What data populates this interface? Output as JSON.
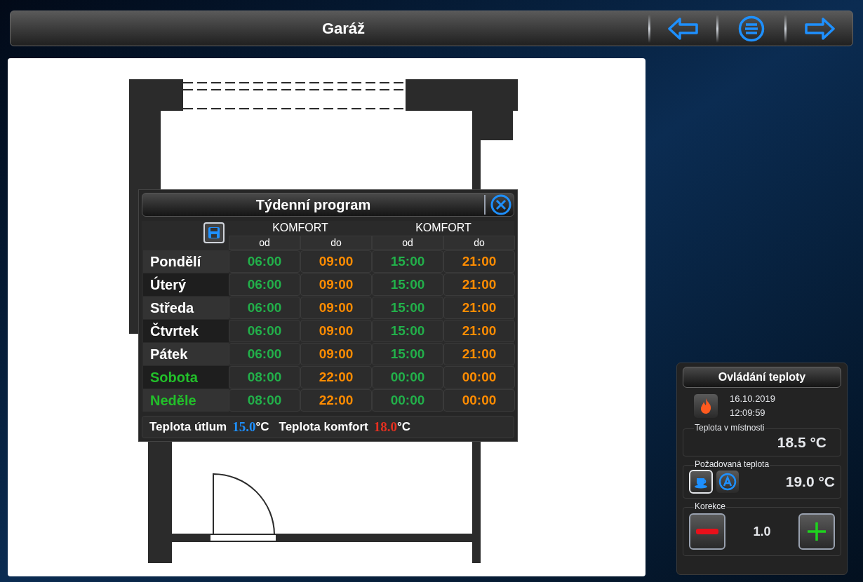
{
  "header": {
    "title": "Garáž"
  },
  "program": {
    "title": "Týdenní program",
    "groups": [
      "KOMFORT",
      "KOMFORT"
    ],
    "subheaders": [
      "od",
      "do",
      "od",
      "do"
    ],
    "days": [
      {
        "name": "Pondělí",
        "color": "#ffffff",
        "times": [
          "06:00",
          "09:00",
          "15:00",
          "21:00"
        ]
      },
      {
        "name": "Úterý",
        "color": "#ffffff",
        "times": [
          "06:00",
          "09:00",
          "15:00",
          "21:00"
        ]
      },
      {
        "name": "Středa",
        "color": "#ffffff",
        "times": [
          "06:00",
          "09:00",
          "15:00",
          "21:00"
        ]
      },
      {
        "name": "Čtvrtek",
        "color": "#ffffff",
        "times": [
          "06:00",
          "09:00",
          "15:00",
          "21:00"
        ]
      },
      {
        "name": "Pátek",
        "color": "#ffffff",
        "times": [
          "06:00",
          "09:00",
          "15:00",
          "21:00"
        ]
      },
      {
        "name": "Sobota",
        "color": "#22c02a",
        "times": [
          "08:00",
          "22:00",
          "00:00",
          "00:00"
        ]
      },
      {
        "name": "Neděle",
        "color": "#22c02a",
        "times": [
          "08:00",
          "22:00",
          "00:00",
          "00:00"
        ]
      }
    ],
    "footer": {
      "setback_label": "Teplota útlum",
      "setback_value": "15.0",
      "setback_unit": "°C",
      "comfort_label": "Teplota komfort",
      "comfort_value": "18.0",
      "comfort_unit": "°C"
    }
  },
  "control": {
    "title": "Ovládání teploty",
    "date": "16.10.2019",
    "time": "12:09:59",
    "room_label": "Teplota v místnosti",
    "room_value": "18.5 °C",
    "target_label": "Požadovaná teplota",
    "target_value": "19.0 °C",
    "modes": [
      {
        "kind": "comfort",
        "selected": true
      },
      {
        "kind": "auto",
        "selected": false
      }
    ],
    "correction_label": "Korekce",
    "correction_value": "1.0"
  }
}
